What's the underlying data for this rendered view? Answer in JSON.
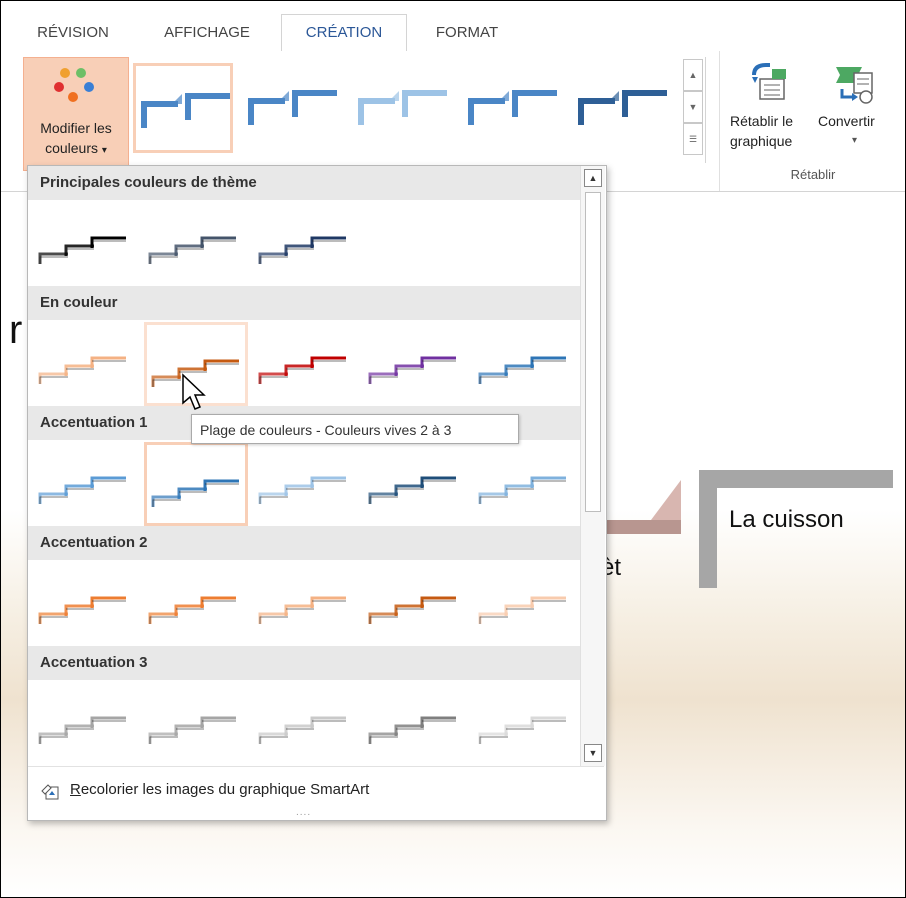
{
  "tabs": [
    "RÉVISION",
    "AFFICHAGE",
    "CRÉATION",
    "FORMAT"
  ],
  "active_tab": "CRÉATION",
  "ribbon": {
    "modifier_line1": "Modifier les",
    "modifier_line2": "couleurs",
    "modifier_caret": "▾",
    "retablir_line1": "Rétablir le",
    "retablir_line2": "graphique",
    "convertir_label": "Convertir",
    "convertir_caret": "▾",
    "group_label": "Rétablir"
  },
  "slide": {
    "title_fragment": "r",
    "text_cuisson": "La cuisson",
    "text_fragment": "èt"
  },
  "panel": {
    "sections": [
      {
        "title": "Principales couleurs de thème",
        "colors": [
          "#000000",
          "#44546a",
          "#1f3864"
        ]
      },
      {
        "title": "En couleur",
        "colors": [
          "#f4b183",
          "#c55a11",
          "#c00000",
          "#7030a0",
          "#2e75b6"
        ]
      },
      {
        "title": "Accentuation 1",
        "colors": [
          "#5b9bd5",
          "#2e75b6",
          "#9dc3e6",
          "#1f4e79",
          "#7fb1dd"
        ]
      },
      {
        "title": "Accentuation 2",
        "colors": [
          "#ed7d31",
          "#ed7d31",
          "#f4b183",
          "#c55a11",
          "#f8cbad"
        ]
      },
      {
        "title": "Accentuation 3",
        "colors": [
          "#a5a5a5",
          "#a5a5a5",
          "#c9c9c9",
          "#7f7f7f",
          "#d9d9d9"
        ]
      }
    ],
    "recolor_label": "Recolorier les images du graphique SmartArt",
    "grip": "....",
    "scroll_up": "▲",
    "scroll_down": "▼"
  },
  "tooltip": "Plage de couleurs - Couleurs vives 2 à 3",
  "icons": [
    "palette-dots-icon",
    "step-arrow-icon",
    "reset-graphic-icon",
    "convert-graphic-icon",
    "recolor-icon",
    "cursor-icon"
  ]
}
